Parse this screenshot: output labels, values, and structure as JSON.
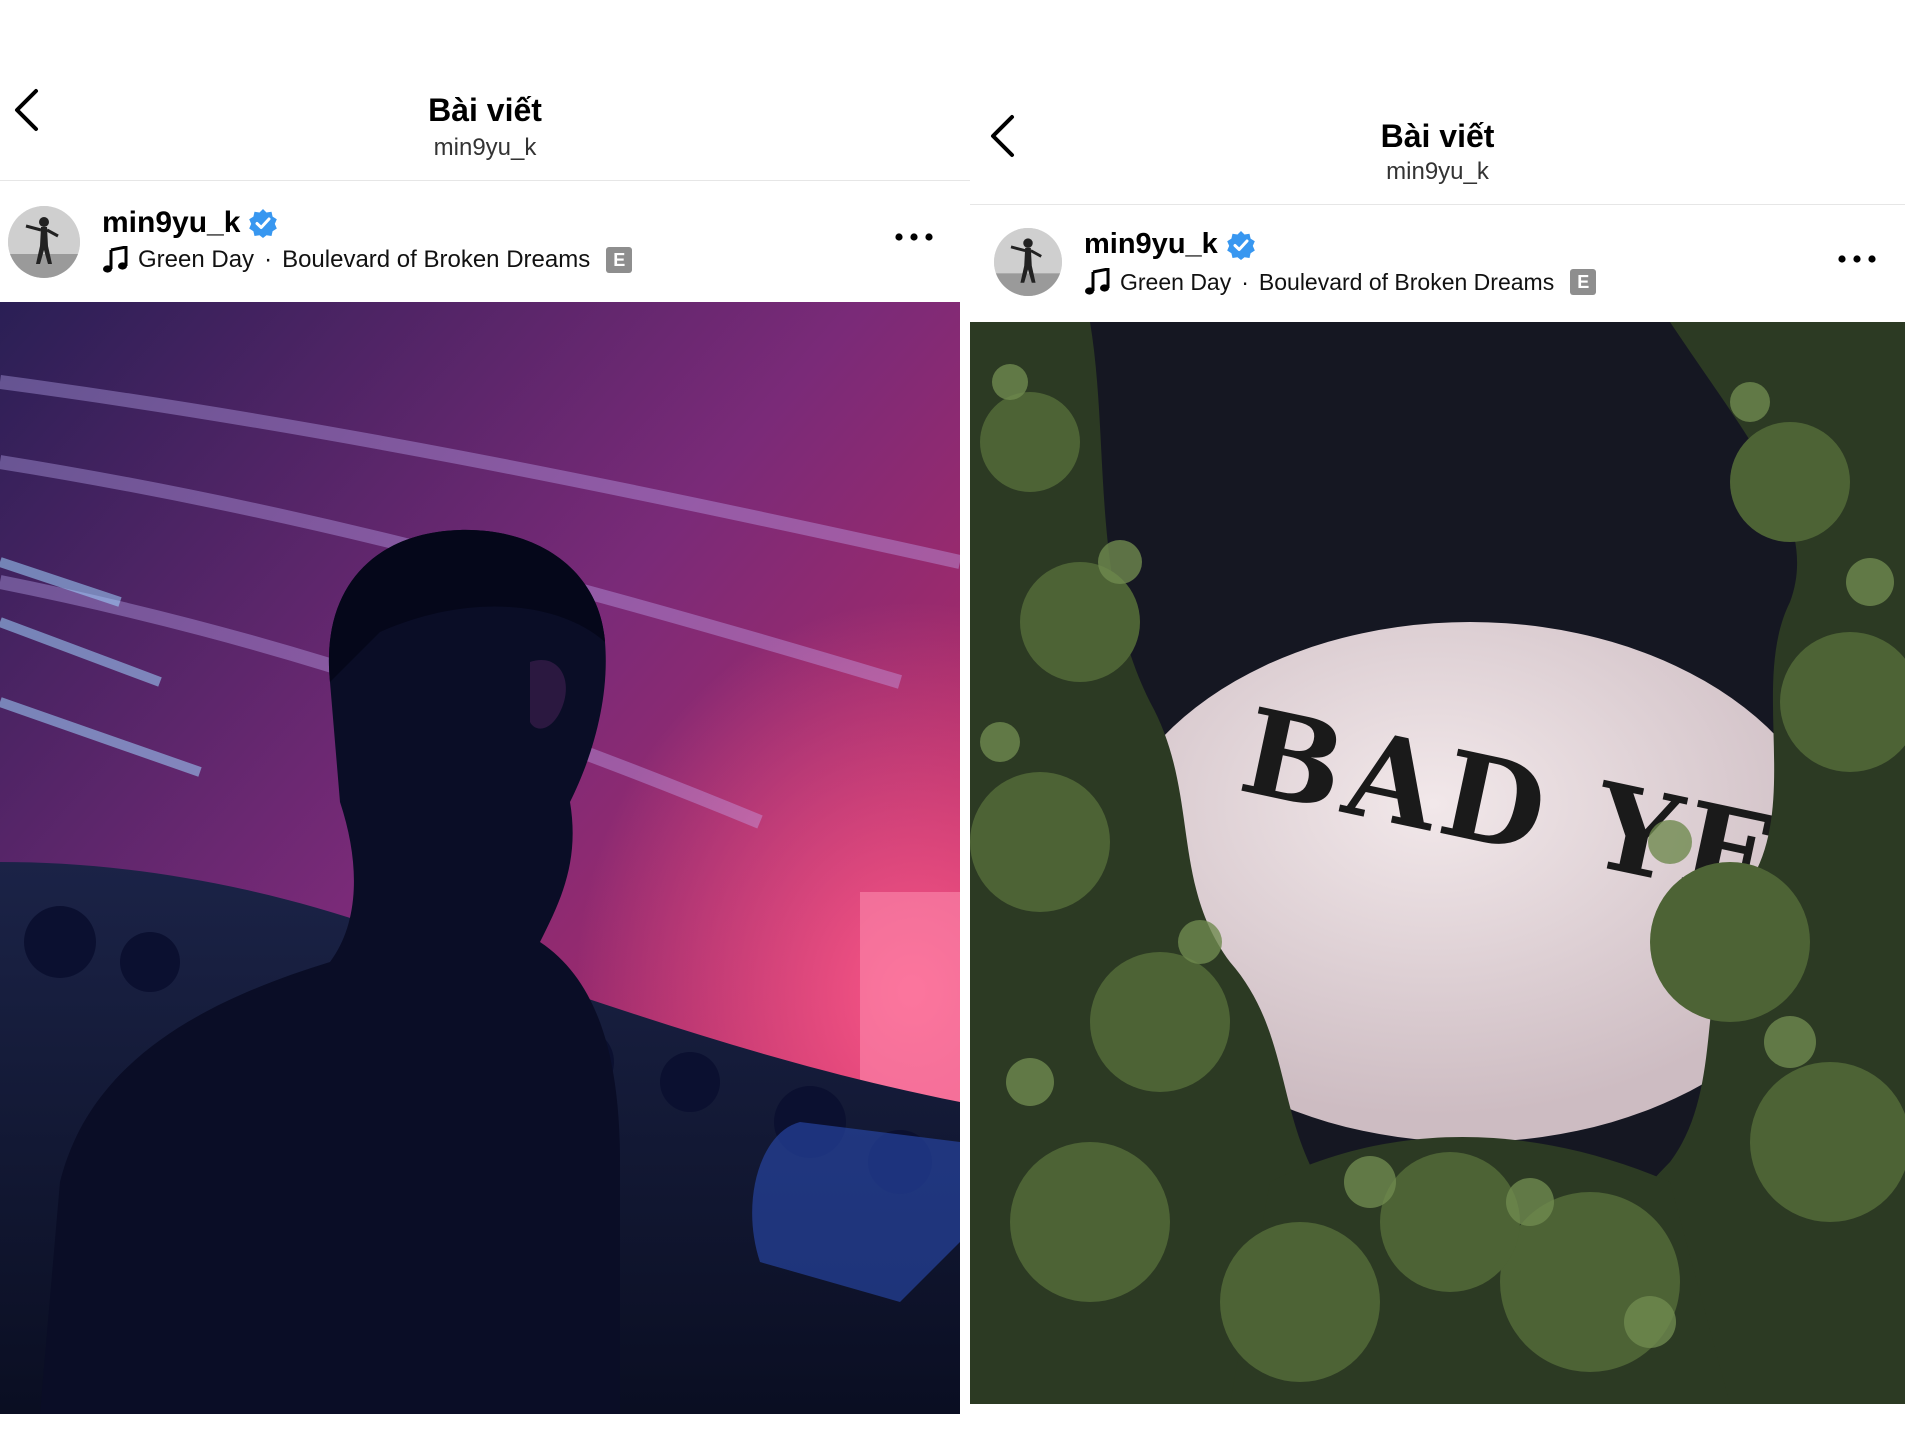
{
  "posts": [
    {
      "nav": {
        "title": "Bài viết",
        "subtitle": "min9yu_k"
      },
      "author": {
        "username": "min9yu_k",
        "verified": true
      },
      "music": {
        "artist": "Green Day",
        "separator": "·",
        "song": "Boulevard of Broken Dreams",
        "explicit_badge": "E"
      },
      "photo": {
        "subject": "concert-crowd-night",
        "colors": {
          "sky_top": "#2a1f55",
          "sky_mid": "#7a2a78",
          "glow": "#e0306a",
          "shadow": "#0f1530"
        }
      }
    },
    {
      "nav": {
        "title": "Bài viết",
        "subtitle": "min9yu_k"
      },
      "author": {
        "username": "min9yu_k",
        "verified": true
      },
      "music": {
        "artist": "Green Day",
        "separator": "·",
        "song": "Boulevard of Broken Dreams",
        "explicit_badge": "E"
      },
      "photo": {
        "subject": "balloon-through-trees",
        "balloon_text": "BAD YEAR",
        "colors": {
          "sky": "#151722",
          "balloon": "#e8dcdf",
          "foliage": "#2c3a23",
          "foliage_light": "#6f8a4f"
        }
      }
    }
  ],
  "accent": {
    "verified_blue": "#3897f0"
  }
}
